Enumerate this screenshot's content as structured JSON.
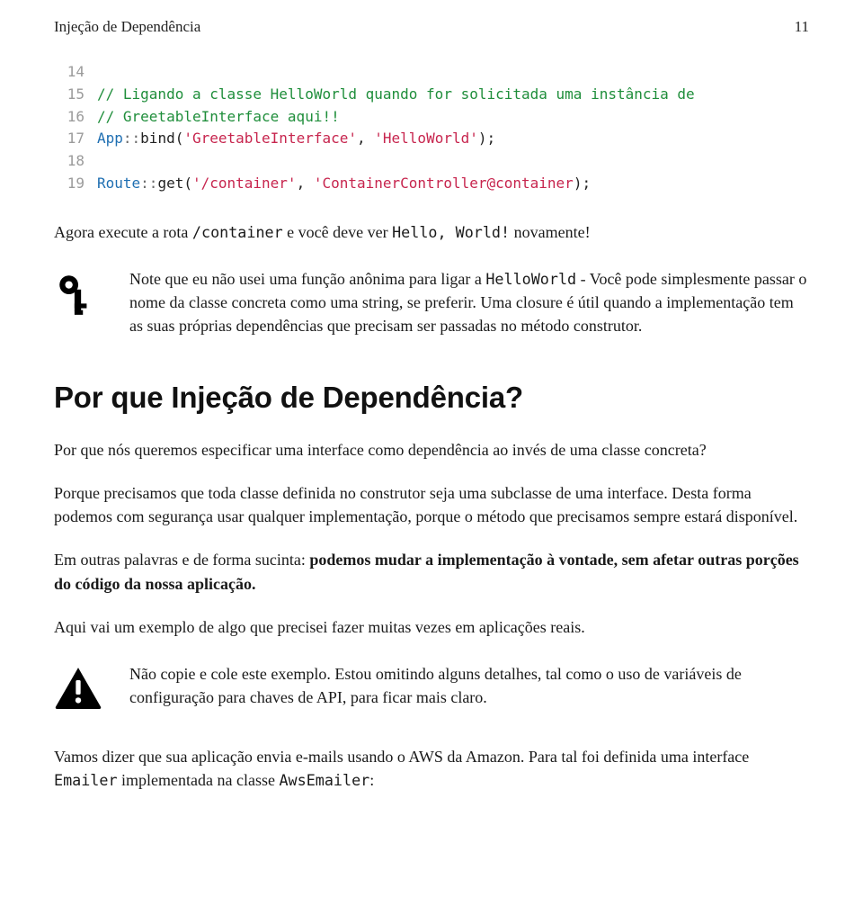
{
  "header": {
    "chapter_title": "Injeção de Dependência",
    "page_number": "11"
  },
  "code": {
    "lines": [
      {
        "n": "14",
        "segments": []
      },
      {
        "n": "15",
        "segments": [
          {
            "cls": "tok-comment",
            "t": "// Ligando a classe HelloWorld quando for solicitada uma instância de"
          }
        ]
      },
      {
        "n": "16",
        "segments": [
          {
            "cls": "tok-comment",
            "t": "// GreetableInterface aqui!!"
          }
        ]
      },
      {
        "n": "17",
        "segments": [
          {
            "cls": "tok-class",
            "t": "App"
          },
          {
            "cls": "tok-op",
            "t": "::"
          },
          {
            "cls": "tok-plain",
            "t": "bind("
          },
          {
            "cls": "tok-string",
            "t": "'GreetableInterface'"
          },
          {
            "cls": "tok-plain",
            "t": ", "
          },
          {
            "cls": "tok-string",
            "t": "'HelloWorld'"
          },
          {
            "cls": "tok-plain",
            "t": ");"
          }
        ]
      },
      {
        "n": "18",
        "segments": []
      },
      {
        "n": "19",
        "segments": [
          {
            "cls": "tok-class",
            "t": "Route"
          },
          {
            "cls": "tok-op",
            "t": "::"
          },
          {
            "cls": "tok-plain",
            "t": "get("
          },
          {
            "cls": "tok-string",
            "t": "'/container'"
          },
          {
            "cls": "tok-plain",
            "t": ", "
          },
          {
            "cls": "tok-string",
            "t": "'ContainerController@container"
          },
          {
            "cls": "tok-plain",
            "t": ");"
          }
        ]
      }
    ]
  },
  "para_after_code": {
    "before_c1": "Agora execute a rota ",
    "c1": "/container",
    "mid": " e você deve ver ",
    "c2": "Hello, World!",
    "after_c2": " novamente!"
  },
  "note_callout": {
    "before_c1": "Note que eu não usei uma função anônima para ligar a ",
    "c1": "HelloWorld",
    "after_c1": " - Você pode simplesmente passar o nome da classe concreta como uma string, se preferir. Uma closure é útil quando a implementação tem as suas próprias dependências que precisam ser passadas no método construtor."
  },
  "section_heading": "Por que Injeção de Dependência?",
  "para1": "Por que nós queremos especificar uma interface como dependência ao invés de uma classe concreta?",
  "para2": "Porque precisamos que toda classe definida no construtor seja uma subclasse de uma interface. Desta forma podemos com segurança usar qualquer implementação, porque o método que precisamos sempre estará disponível.",
  "para3": {
    "lead": "Em outras palavras e de forma sucinta: ",
    "bold": "podemos mudar a implementação à vontade, sem afetar outras porções do código da nossa aplicação.",
    "tail": ""
  },
  "para4": "Aqui vai um exemplo de algo que precisei fazer muitas vezes em aplicações reais.",
  "warn_callout": "Não copie e cole este exemplo. Estou omitindo alguns detalhes, tal como o uso de variáveis de configuração para chaves de API, para ficar mais claro.",
  "para5": {
    "before_c1": "Vamos dizer que sua aplicação envia e-mails usando o AWS da Amazon. Para tal foi definida uma interface ",
    "c1": "Emailer",
    "mid": " implementada na classe ",
    "c2": "AwsEmailer",
    "after_c2": ":"
  }
}
